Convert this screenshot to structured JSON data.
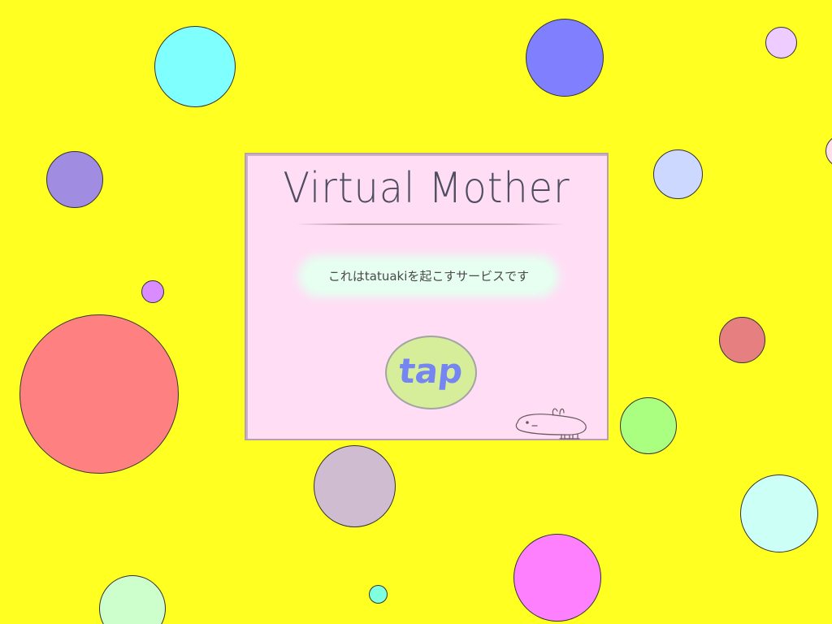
{
  "app": {
    "title": "Virtual Mother",
    "subtitle": "これはtatuakiを起こすサービスです",
    "tap_label": "tap",
    "mascot_icon": "rabbit-doodle-icon"
  },
  "background": {
    "color": "#ffff22",
    "dots": [
      {
        "id": "d1",
        "color": "#80ffff"
      },
      {
        "id": "d2",
        "color": "#8080ff"
      },
      {
        "id": "d3",
        "color": "#eeccff"
      },
      {
        "id": "d4",
        "color": "#a08ce0"
      },
      {
        "id": "d5",
        "color": "#ccd8ff"
      },
      {
        "id": "d6",
        "color": "#ffe0e8"
      },
      {
        "id": "d7",
        "color": "#d98cff"
      },
      {
        "id": "d8",
        "color": "#ff8080"
      },
      {
        "id": "d9",
        "color": "#e68080"
      },
      {
        "id": "d10",
        "color": "#aaff80"
      },
      {
        "id": "d11",
        "color": "#d0bcd0"
      },
      {
        "id": "d12",
        "color": "#ccfff5"
      },
      {
        "id": "d13",
        "color": "#ff80ff"
      },
      {
        "id": "d14",
        "color": "#ccffcc"
      },
      {
        "id": "d15",
        "color": "#80ffe0"
      }
    ]
  },
  "colors": {
    "card": "#ffddf5",
    "button": "#d6ee9a",
    "button_text": "#7585f2",
    "title_text": "#4e4e60"
  }
}
